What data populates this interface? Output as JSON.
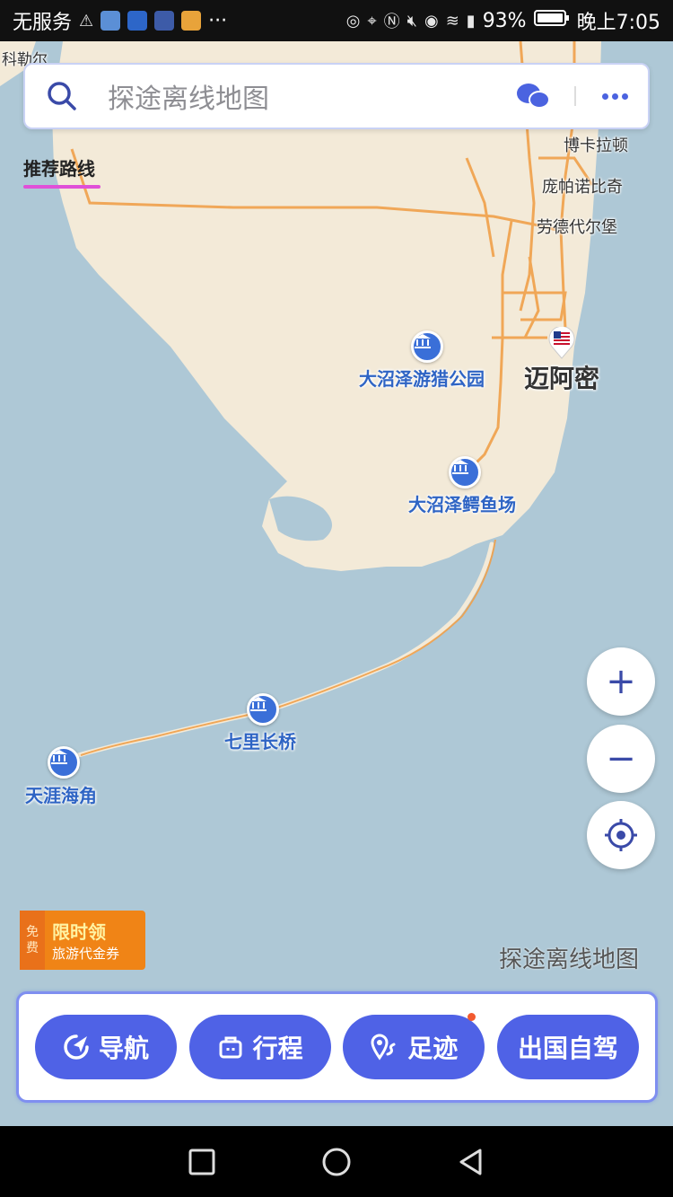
{
  "status_bar": {
    "carrier": "无服务",
    "more": "···",
    "battery_pct": "93%",
    "time": "晚上7:05"
  },
  "search": {
    "placeholder": "探途离线地图"
  },
  "recommend_tab": "推荐路线",
  "map": {
    "places": {
      "keller": "科勒尔",
      "boca": "博卡拉顿",
      "pompano": "庞帕诺比奇",
      "lauderdale": "劳德代尔堡",
      "miami": "迈阿密"
    },
    "pois": {
      "everglades_park": "大沼泽游猎公园",
      "alligator_farm": "大沼泽鳄鱼场",
      "seven_mile_bridge": "七里长桥",
      "key_west": "天涯海角"
    },
    "watermark": "探途离线地图",
    "colors": {
      "land": "#f3ead8",
      "water": "#aec8d6",
      "road": "#f0a04a",
      "poi": "#3a6fd8"
    }
  },
  "controls": {
    "zoom_in": "+",
    "zoom_out": "−"
  },
  "promo": {
    "free": [
      "免",
      "费"
    ],
    "title": "限时领",
    "subtitle": "旅游代金券"
  },
  "bottom_bar": {
    "navigate": "导航",
    "itinerary": "行程",
    "footprint": "足迹",
    "abroad_drive": "出国自驾"
  }
}
